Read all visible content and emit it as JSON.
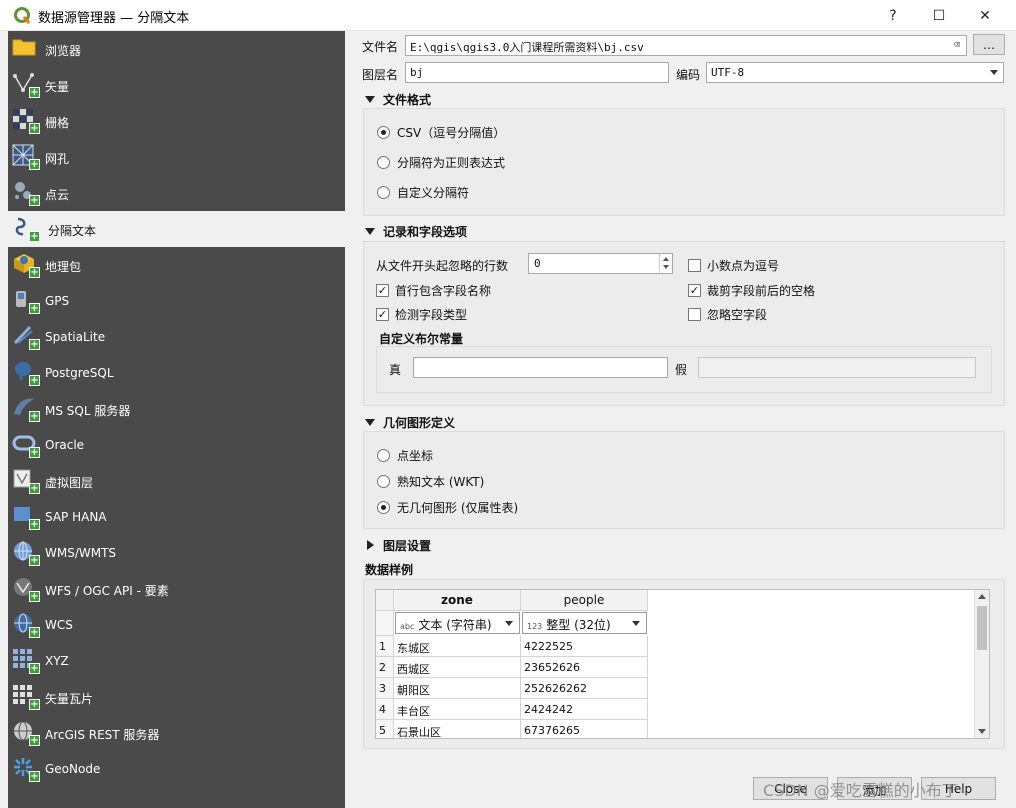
{
  "window": {
    "title": "数据源管理器 — 分隔文本",
    "help_label": "?",
    "maximize_label": "☐",
    "close_label": "✕"
  },
  "sidebar": {
    "items": [
      {
        "label": "浏览器",
        "icon": "folder-icon"
      },
      {
        "label": "矢量",
        "icon": "vector-icon"
      },
      {
        "label": "栅格",
        "icon": "raster-icon"
      },
      {
        "label": "网孔",
        "icon": "mesh-icon"
      },
      {
        "label": "点云",
        "icon": "point-cloud-icon"
      },
      {
        "label": "分隔文本",
        "icon": "delimited-text-icon"
      },
      {
        "label": "地理包",
        "icon": "geopackage-icon"
      },
      {
        "label": "GPS",
        "icon": "gps-icon"
      },
      {
        "label": "SpatiaLite",
        "icon": "spatialite-icon"
      },
      {
        "label": "PostgreSQL",
        "icon": "postgresql-icon"
      },
      {
        "label": "MS SQL 服务器",
        "icon": "mssql-icon"
      },
      {
        "label": "Oracle",
        "icon": "oracle-icon"
      },
      {
        "label": "虚拟图层",
        "icon": "virtual-layer-icon"
      },
      {
        "label": "SAP HANA",
        "icon": "sap-hana-icon"
      },
      {
        "label": "WMS/WMTS",
        "icon": "wms-icon"
      },
      {
        "label": "WFS / OGC API - 要素",
        "icon": "wfs-icon"
      },
      {
        "label": "WCS",
        "icon": "wcs-icon"
      },
      {
        "label": "XYZ",
        "icon": "xyz-icon"
      },
      {
        "label": "矢量瓦片",
        "icon": "vector-tile-icon"
      },
      {
        "label": "ArcGIS REST 服务器",
        "icon": "arcgis-icon"
      },
      {
        "label": "GeoNode",
        "icon": "geonode-icon"
      }
    ],
    "active_index": 5
  },
  "file": {
    "label": "文件名",
    "value": "E:\\qgis\\qgis3.0入门课程所需资料\\bj.csv",
    "browse_label": "…"
  },
  "layer": {
    "label": "图层名",
    "value": "bj",
    "encoding_label": "编码",
    "encoding_value": "UTF-8"
  },
  "file_format": {
    "title": "文件格式",
    "options": [
      "CSV（逗号分隔值）",
      "分隔符为正则表达式",
      "自定义分隔符"
    ],
    "selected": 0
  },
  "records": {
    "title": "记录和字段选项",
    "skip_lines_label": "从文件开头起忽略的行数",
    "skip_lines_value": "0",
    "decimal_comma_label": "小数点为逗号",
    "decimal_comma_checked": false,
    "header_label": "首行包含字段名称",
    "header_checked": true,
    "trim_label": "裁剪字段前后的空格",
    "trim_checked": true,
    "detect_types_label": "检测字段类型",
    "detect_types_checked": true,
    "discard_empty_label": "忽略空字段",
    "discard_empty_checked": false,
    "bool_title": "自定义布尔常量",
    "true_label": "真",
    "false_label": "假"
  },
  "geometry": {
    "title": "几何图形定义",
    "options": [
      "点坐标",
      "熟知文本 (WKT)",
      "无几何图形 (仅属性表)"
    ],
    "selected": 2
  },
  "layer_settings": {
    "title": "图层设置"
  },
  "sample": {
    "title": "数据样例",
    "columns": [
      {
        "name": "zone",
        "type_tag": "abc",
        "type": "文本 (字符串)"
      },
      {
        "name": "people",
        "type_tag": "123",
        "type": "整型 (32位)"
      }
    ],
    "rows": [
      {
        "n": "1",
        "zone": "东城区",
        "people": "4222525"
      },
      {
        "n": "2",
        "zone": "西城区",
        "people": "23652626"
      },
      {
        "n": "3",
        "zone": "朝阳区",
        "people": "252626262"
      },
      {
        "n": "4",
        "zone": "丰台区",
        "people": "2424242"
      },
      {
        "n": "5",
        "zone": "石景山区",
        "people": "67376265"
      }
    ]
  },
  "footer": {
    "close_label": "Close",
    "add_label": "添加",
    "help_label": "Help"
  },
  "watermark": "CSDN @爱吃雪糕的小布丁"
}
